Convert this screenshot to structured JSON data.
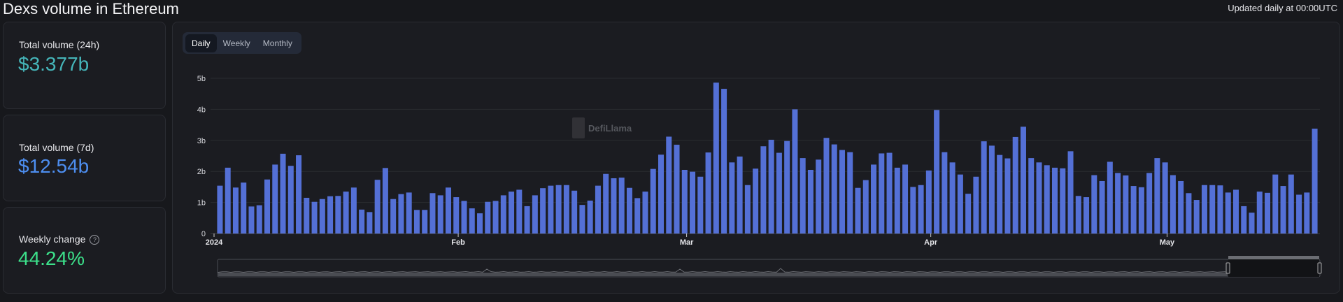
{
  "header": {
    "title": "Dexs volume in Ethereum",
    "updated": "Updated daily at 00:00UTC"
  },
  "stats": [
    {
      "label": "Total volume (24h)",
      "value": "$3.377b",
      "color": "#45b5b9"
    },
    {
      "label": "Total volume (7d)",
      "value": "$12.54b",
      "color": "#4d8ef0"
    },
    {
      "label": "Weekly change",
      "value": "44.24%",
      "color": "#3ce08a",
      "help_icon": "question-circle-icon"
    }
  ],
  "tabs": [
    {
      "label": "Daily",
      "active": true
    },
    {
      "label": "Weekly",
      "active": false
    },
    {
      "label": "Monthly",
      "active": false
    }
  ],
  "watermark": "DefiLlama",
  "chart_data": {
    "type": "bar",
    "x_start": "2024-01-01",
    "x_end": "2024-05-19",
    "x_ticks": [
      {
        "label": "2024",
        "date": "2024-01-01"
      },
      {
        "label": "Feb",
        "date": "2024-02-01"
      },
      {
        "label": "Mar",
        "date": "2024-03-01"
      },
      {
        "label": "Apr",
        "date": "2024-04-01"
      },
      {
        "label": "May",
        "date": "2024-05-01"
      }
    ],
    "y_ticks": [
      {
        "label": "0",
        "value": 0
      },
      {
        "label": "1b",
        "value": 1
      },
      {
        "label": "2b",
        "value": 2
      },
      {
        "label": "3b",
        "value": 3
      },
      {
        "label": "4b",
        "value": 4
      },
      {
        "label": "5b",
        "value": 5
      }
    ],
    "ylim": [
      0,
      5
    ],
    "y_unit": "billion USD",
    "grid": true,
    "bar_color": "#5470d6",
    "values": [
      1.54,
      2.12,
      1.48,
      1.64,
      0.87,
      0.91,
      1.74,
      2.22,
      2.57,
      2.18,
      2.52,
      1.15,
      1.02,
      1.11,
      1.2,
      1.21,
      1.35,
      1.48,
      0.77,
      0.69,
      1.73,
      2.11,
      1.11,
      1.27,
      1.32,
      0.76,
      0.76,
      1.3,
      1.23,
      1.48,
      1.17,
      1.05,
      0.81,
      0.65,
      1.02,
      1.05,
      1.23,
      1.35,
      1.41,
      0.88,
      1.23,
      1.46,
      1.54,
      1.56,
      1.56,
      1.38,
      0.92,
      1.06,
      1.54,
      1.92,
      1.78,
      1.8,
      1.47,
      1.14,
      1.35,
      2.08,
      2.54,
      3.12,
      2.86,
      2.05,
      1.99,
      1.83,
      2.61,
      4.86,
      4.66,
      2.29,
      2.48,
      1.56,
      2.09,
      2.81,
      3.02,
      2.6,
      2.98,
      4.0,
      2.43,
      2.05,
      2.38,
      3.08,
      2.87,
      2.69,
      2.62,
      1.47,
      1.72,
      2.22,
      2.58,
      2.6,
      2.12,
      2.22,
      1.5,
      1.56,
      2.03,
      3.98,
      2.62,
      2.29,
      1.9,
      1.28,
      1.83,
      2.97,
      2.83,
      2.53,
      2.42,
      3.11,
      3.44,
      2.43,
      2.29,
      2.2,
      2.12,
      2.1,
      2.65,
      1.21,
      1.17,
      1.88,
      1.69,
      2.31,
      1.95,
      1.87,
      1.53,
      1.49,
      1.95,
      2.43,
      2.29,
      1.88,
      1.69,
      1.3,
      1.08,
      1.56,
      1.56,
      1.55,
      1.32,
      1.41,
      0.88,
      0.67,
      1.35,
      1.31,
      1.9,
      1.53,
      1.9,
      1.25,
      1.32,
      3.377
    ]
  }
}
